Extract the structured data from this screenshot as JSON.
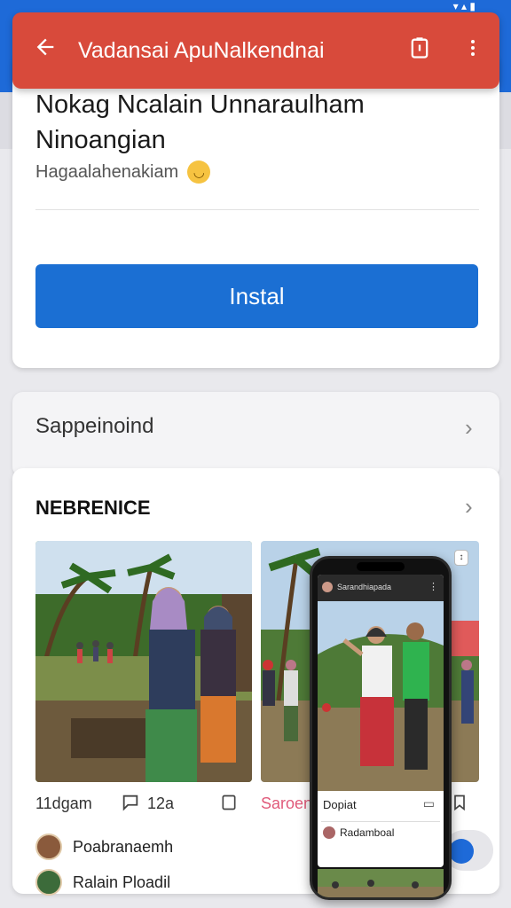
{
  "status_bar": {
    "text": ""
  },
  "app_bar": {
    "title": "Vadansai ApuNalkendnai",
    "back_icon": "arrow-left-icon",
    "action_icon": "phone-device-icon",
    "menu_icon": "more-vert-icon",
    "color": "#d84a3b"
  },
  "app": {
    "name_line1": "Nokag Ncalain Unnaraulham",
    "name_line2": "Ninoangian",
    "subtitle": "Hagaalahenakiam",
    "install_label": "Instal",
    "install_color": "#1b6fd3"
  },
  "support": {
    "label": "Sappeinoind"
  },
  "section": {
    "title": "NEBRENICE",
    "stats": {
      "count_label": "11dgam",
      "likes": "12a",
      "author": "Saroen"
    },
    "comments": [
      {
        "name": "Poabranaemh"
      },
      {
        "name": "Ralain Ploadil"
      }
    ]
  },
  "phone_preview": {
    "app_title": "Sarandhiapada",
    "caption": "Dopiat",
    "user": "Radamboal"
  },
  "colors": {
    "accent_blue": "#1e6ad8",
    "red": "#d84a3b"
  }
}
